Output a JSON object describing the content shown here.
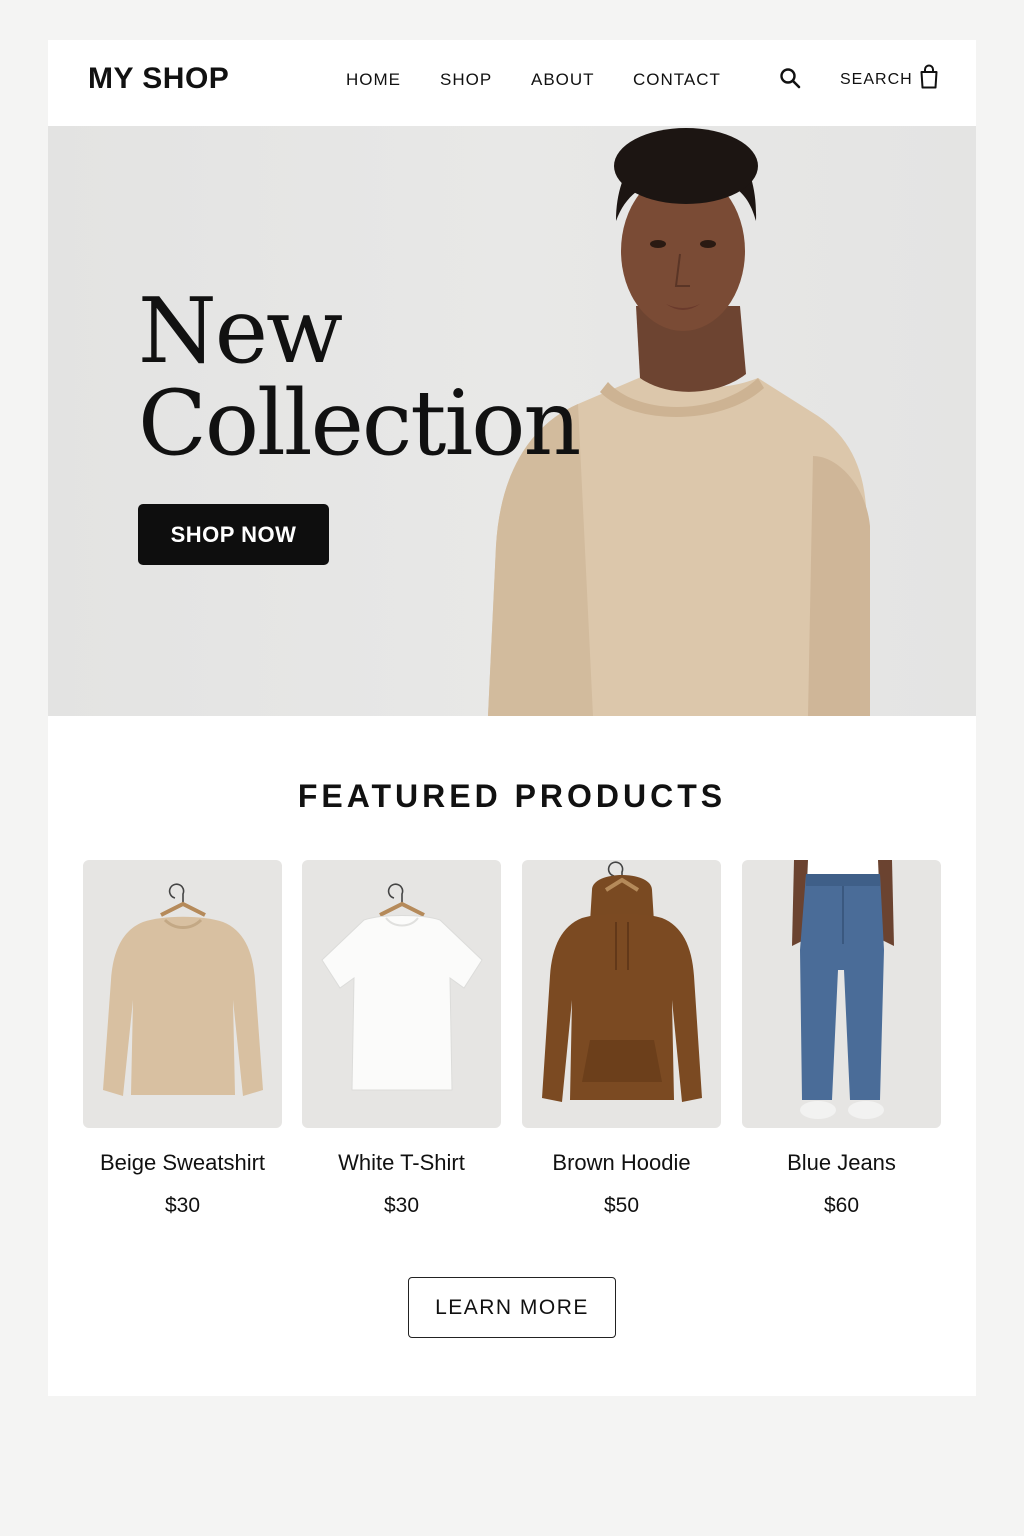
{
  "header": {
    "logo": "MY SHOP",
    "nav": [
      {
        "label": "HOME"
      },
      {
        "label": "SHOP"
      },
      {
        "label": "ABOUT"
      },
      {
        "label": "CONTACT"
      }
    ],
    "search_label": "SEARCH",
    "search_icon": "search-icon",
    "cart_icon": "shopping-bag-icon"
  },
  "hero": {
    "title_line1": "New",
    "title_line2": "Collection",
    "cta_label": "SHOP NOW"
  },
  "featured": {
    "title": "FEATURED PRODUCTS",
    "products": [
      {
        "name": "Beige Sweatshirt",
        "price": "$30",
        "color": "#d8bfa0"
      },
      {
        "name": "White T-Shirt",
        "price": "$30",
        "color": "#f7f7f6"
      },
      {
        "name": "Brown Hoodie",
        "price": "$50",
        "color": "#7a4a22"
      },
      {
        "name": "Blue Jeans",
        "price": "$60",
        "color": "#4a6a94"
      }
    ]
  },
  "learn_more_label": "LEARN MORE",
  "colors": {
    "accent": "#0e0e0e",
    "hero_bg": "#e6e6e5",
    "sweatshirt": "#d8c1a4"
  }
}
